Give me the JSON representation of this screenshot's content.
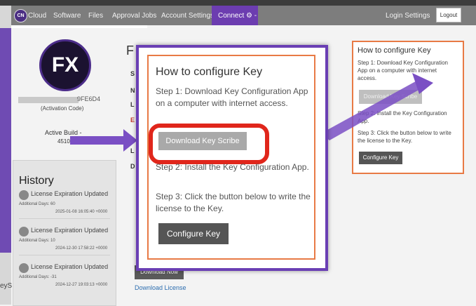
{
  "nav": {
    "logo_text": "CN",
    "brand": "Cloud",
    "items": [
      "Software",
      "Files",
      "Approval Jobs",
      "Account Settings"
    ],
    "connect": "Connect ⚙ -",
    "login_settings": "Login Settings",
    "logout": "Logout"
  },
  "profile": {
    "logo_text": "FX",
    "code_suffix": "9FE6D4",
    "code_label": "(Activation Code)",
    "build_label": "Active Build -",
    "build_value": "4510"
  },
  "history": {
    "title": "History",
    "items": [
      {
        "title": "License Expiration Updated",
        "days": "Additional Days: 60",
        "date": "2025-01-08 16:05:40 +0000"
      },
      {
        "title": "License Expiration Updated",
        "days": "Additional Days: 10",
        "date": "2024-12-30 17:58:22 +0000"
      },
      {
        "title": "License Expiration Updated",
        "days": "Additional Days: -31",
        "date": "2024-12-27 19:03:13 +0000"
      }
    ]
  },
  "bottom_left_text": "eyS",
  "main": {
    "heading_letter": "F",
    "side_letters": [
      "S",
      "N",
      "L",
      "E",
      "L",
      "D"
    ],
    "download_now": "Download Now",
    "download_license": "Download License"
  },
  "modal": {
    "title": "How to configure Key",
    "step1": "Step 1: Download Key Configuration App on a computer with internet access.",
    "download_button": "Download Key Scribe",
    "step2": "Step 2: Install the Key Configuration App.",
    "step3": "Step 3: Click the button below to write the license to the Key.",
    "configure_button": "Configure Key"
  },
  "rightbox": {
    "title": "How to configure Key",
    "step1": "Step 1: Download Key Configuration App on a computer with internet access.",
    "download_button": "Download Key Scribe",
    "step2": "Step 2: Install the Key Configuration App.",
    "step3": "Step 3: Click the button below to write the license to the Key.",
    "configure_button": "Configure Key"
  },
  "colors": {
    "accent_purple": "#6a3fb4",
    "highlight_red": "#e0261b",
    "frame_orange": "#e87a45"
  }
}
